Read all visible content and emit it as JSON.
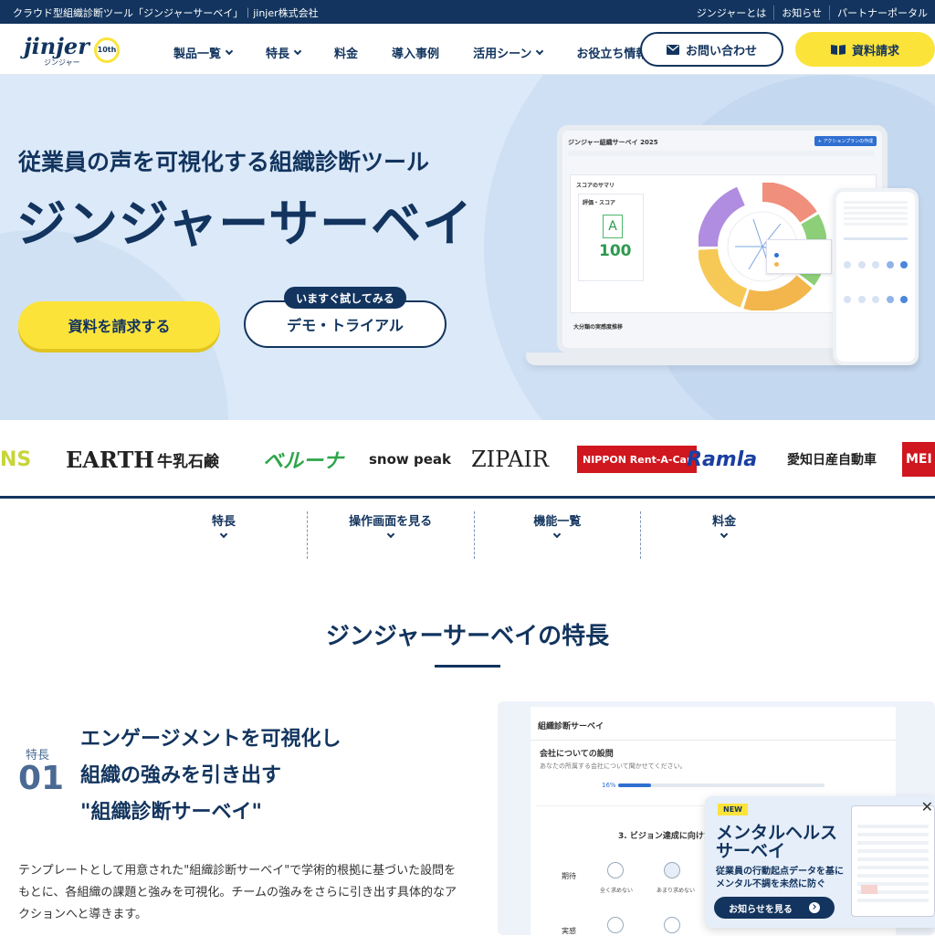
{
  "topbar": {
    "tagline": "クラウド型組織診断ツール「ジンジャーサーベイ」｜jinjer株式会社",
    "links": [
      "ジンジャーとは",
      "お知らせ",
      "パートナーポータル"
    ]
  },
  "header": {
    "logo_text": "jinjer",
    "logo_sub": "ジンジャー",
    "logo_badge": "10th",
    "nav": [
      "製品一覧",
      "特長",
      "料金",
      "導入事例",
      "活用シーン",
      "お役立ち情報"
    ],
    "contact_label": "お問い合わせ",
    "doc_label": "資料請求"
  },
  "hero": {
    "subtitle": "従業員の声を可視化する組織診断ツール",
    "title": "ジンジャーサーベイ",
    "cta_primary": "資料を請求する",
    "cta_tag": "いますぐ試してみる",
    "cta_secondary": "デモ・トライアル",
    "mock": {
      "screen_title": "ジンジャー組織サーベイ 2025",
      "action_btn": "+ アクションプランの作成",
      "summary_label": "スコアのサマリ",
      "score_label": "評価・スコア",
      "grade": "A",
      "score": "100",
      "bottom_label": "大分類の実感度推移"
    }
  },
  "logos": [
    "NS",
    "EARTH",
    "牛乳石鹸",
    "ベルーナ",
    "snow peak",
    "ZIPAIR",
    "NIPPON Rent-A-Car",
    "Ramla",
    "愛知日産自動車",
    "MEI SPO"
  ],
  "subnav": [
    "特長",
    "操作画面を見る",
    "機能一覧",
    "料金"
  ],
  "features": {
    "section_title": "ジンジャーサーベイの特長",
    "label": "特長",
    "number": "01",
    "headline": [
      "エンゲージメントを可視化し",
      "組織の強みを引き出す",
      "\"組織診断サーベイ\""
    ],
    "description": "テンプレートとして用意された\"組織診断サーベイ\"で学術的根拠に基づいた設問をもとに、各組織の課題と強みを可視化。チームの強みをさらに引き出す具体的なアクションへと導きます。",
    "survey_mock": {
      "title": "組織診断サーベイ",
      "section": "会社についての設問",
      "hint": "あなたの所属する会社について聞かせてください。",
      "progress": "16%",
      "question": "3. ビジョン達成に向けた",
      "row1": "期待",
      "row2": "実感",
      "opt1": "全く求めない",
      "opt2": "あまり求めない"
    }
  },
  "popup": {
    "badge": "NEW",
    "title": "メンタルヘルス\nサーベイ",
    "title_line1": "メンタルヘルス",
    "title_line2": "サーベイ",
    "desc_line1": "従業員の行動起点データを基に",
    "desc_line2": "メンタル不調を未然に防ぐ",
    "button": "お知らせを見る"
  },
  "colors": {
    "navy": "#12345e",
    "yellow": "#fce33a",
    "hero_bg": "#dbe9f9"
  }
}
